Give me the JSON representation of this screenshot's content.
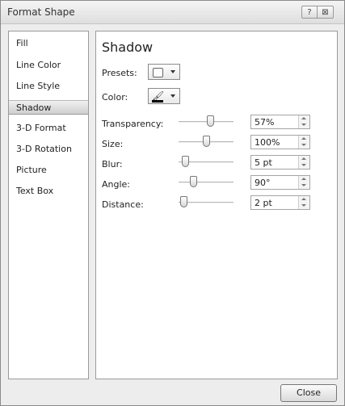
{
  "window": {
    "title": "Format Shape",
    "help_glyph": "?",
    "close_glyph": "⊠"
  },
  "nav": {
    "items": [
      {
        "label": "Fill"
      },
      {
        "label": "Line Color"
      },
      {
        "label": "Line Style"
      },
      {
        "label": "Shadow",
        "selected": true
      },
      {
        "label": "3-D Format"
      },
      {
        "label": "3-D Rotation"
      },
      {
        "label": "Picture"
      },
      {
        "label": "Text Box"
      }
    ]
  },
  "shadow": {
    "heading": "Shadow",
    "presets_label": "Presets:",
    "color_label": "Color:",
    "color_icon": "paint-bucket-icon",
    "color_value": "#000000",
    "settings": [
      {
        "label": "Transparency:",
        "value": "57%",
        "level": 0.57
      },
      {
        "label": "Size:",
        "value": "100%",
        "level": 0.5
      },
      {
        "label": "Blur:",
        "value": "5 pt",
        "level": 0.05
      },
      {
        "label": "Angle:",
        "value": "90°",
        "level": 0.25
      },
      {
        "label": "Distance:",
        "value": "2 pt",
        "level": 0.02
      }
    ]
  },
  "footer": {
    "close_label": "Close"
  }
}
